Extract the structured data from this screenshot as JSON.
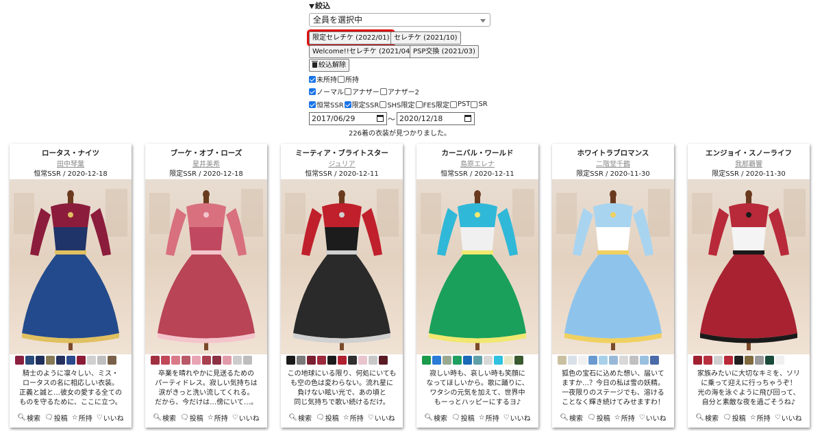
{
  "filter": {
    "title": "絞込",
    "select_value": "全員を選択中",
    "gacha_buttons": [
      {
        "label": "限定セレチケ (2022/01)",
        "active": true
      },
      {
        "label": "セレチケ (2021/10)",
        "active": false
      },
      {
        "label": "Welcome!!セレチケ (2021/04)",
        "active": false
      },
      {
        "label": "PSP交換 (2021/03)",
        "active": false
      }
    ],
    "clear_label": "絞込解除",
    "ownership": [
      {
        "label": "未所持",
        "checked": true
      },
      {
        "label": "所持",
        "checked": false
      }
    ],
    "variants": [
      {
        "label": "ノーマル",
        "checked": true
      },
      {
        "label": "アナザー",
        "checked": false
      },
      {
        "label": "アナザー2",
        "checked": false
      }
    ],
    "rarities": [
      {
        "label": "恒常SSR",
        "checked": true
      },
      {
        "label": "限定SSR",
        "checked": true
      },
      {
        "label": "SHS限定",
        "checked": false
      },
      {
        "label": "FES限定",
        "checked": false
      },
      {
        "label": "PST",
        "checked": false
      },
      {
        "label": "SR",
        "checked": false
      }
    ],
    "date_from": "2017/06/29",
    "date_to": "2020/12/18",
    "tilde": "～",
    "result_text": "226着の衣装が見つかりました。"
  },
  "actions": {
    "search": "検索",
    "post": "投稿",
    "own": "所持",
    "like": "いいね"
  },
  "cards": [
    {
      "name": "ロータス・ナイツ",
      "idol": "田中琴葉",
      "meta": "恒常SSR / 2020-12-18",
      "desc": [
        "騎士のように凛々しい、ミス・",
        "ロータスの名に相応しい衣装。",
        "正義と誠と…彼女の愛する全ての",
        "ものを守るために、ここに立つ。"
      ],
      "swatches": [
        "#8a2040",
        "#2a4a7a",
        "#1e2f5a",
        "#857a55",
        "#24305e",
        "#2c4a8c",
        "#8c1c36",
        "#d0d0d0",
        "#bfbfbf",
        "#7a6048"
      ],
      "palette": {
        "top": "#8c1c3c",
        "accent": "#1f3468",
        "skirt": "#234a8c",
        "trim": "#e0c060"
      }
    },
    {
      "name": "ブーケ・オブ・ローズ",
      "idol": "星井美希",
      "meta": "限定SSR / 2020-12-18",
      "desc": [
        "卒業を晴れやかに見送るための",
        "パーティドレス。寂しい気持ちは",
        "涙がきっと洗い流してくれる。",
        "だから、今だけは…傍にいて…。"
      ],
      "swatches": [
        "#a03040",
        "#c04858",
        "#d87a88",
        "#b85868",
        "#e8a4b4",
        "#a84050",
        "#8c3044",
        "#e09aa8",
        "#cccccc",
        "#bdbdbd"
      ],
      "palette": {
        "top": "#d8707e",
        "accent": "#c04860",
        "skirt": "#b84456",
        "trim": "#f4c4cc"
      }
    },
    {
      "name": "ミーティア・ブライトスター",
      "idol": "ジュリア",
      "meta": "恒常SSR / 2020-12-11",
      "desc": [
        "この地球にいる限り、何処にいても",
        "も空の色は変わらない。流れ星に",
        "負けない眩い光で、あの頃と",
        "同じ気持ちで歌い続けるだけ。"
      ],
      "swatches": [
        "#1a1a1a",
        "#7a7a7a",
        "#7a2030",
        "#9c2a3c",
        "#1c1c1c",
        "#b02030",
        "#303030",
        "#e8c4cc",
        "#c8c8c8",
        "#5a1a24"
      ],
      "palette": {
        "top": "#c0202c",
        "accent": "#1c1c1c",
        "skirt": "#2a2a2a",
        "trim": "#d0d0d0"
      }
    },
    {
      "name": "カーニバル・ワールド",
      "idol": "島原エレナ",
      "meta": "恒常SSR / 2020-12-11",
      "desc": [
        "寂しい時も、哀しい時も笑顔に",
        "なってほしいから。歌に踊りに、",
        "ワタシの元気を加えて、世界中",
        "もーっとハッピーにするヨ♪"
      ],
      "swatches": [
        "#1a9a4a",
        "#2a7ad8",
        "#9aa890",
        "#20a060",
        "#1a6ab8",
        "#60a0a8",
        "#d8d8d8",
        "#30c0e0",
        "#e8e8c8",
        "#3a5a30"
      ],
      "palette": {
        "top": "#30b8d8",
        "accent": "#f0f0f0",
        "skirt": "#1aa05a",
        "trim": "#f0e870"
      }
    },
    {
      "name": "ホワイトラブロマンス",
      "idol": "二階堂千鶴",
      "meta": "限定SSR / 2020-11-30",
      "desc": [
        "狐色の宝石に込めた想い、届いて",
        "ますか…？今日の私は雪の妖精。",
        "一夜限りのステージでも、溶ける",
        "ことなく輝き続けてみせますわ！"
      ],
      "swatches": [
        "#c8c0a0",
        "#d8e0e8",
        "#f0f0f0",
        "#6a9ad0",
        "#a8d0e8",
        "#98b8d8",
        "#d8d8d8",
        "#c0c0c0",
        "#9ac0e0",
        "#4a6aa8"
      ],
      "palette": {
        "top": "#a8d4f0",
        "accent": "#ffffff",
        "skirt": "#8ec4ec",
        "trim": "#f0d060"
      }
    },
    {
      "name": "エンジョイ・スノーライフ",
      "idol": "我那覇響",
      "meta": "限定SSR / 2020-11-30",
      "desc": [
        "家族みたいに大切なキミを、ソリ",
        "に乗って迎えに行っちゃうぞ！",
        "光の海を泳ぐように飛び回って、",
        "自分と素敵な夜を過ごそうね♪"
      ],
      "swatches": [
        "#a02030",
        "#b83040",
        "#d0d0d0",
        "#b82838",
        "#202020",
        "#806a40",
        "#9a9a9a",
        "#1a4a3a",
        "#f0f0f0"
      ],
      "palette": {
        "top": "#b82a3a",
        "accent": "#f4f4f4",
        "skirt": "#a82232",
        "trim": "#1a1a1a"
      }
    }
  ]
}
